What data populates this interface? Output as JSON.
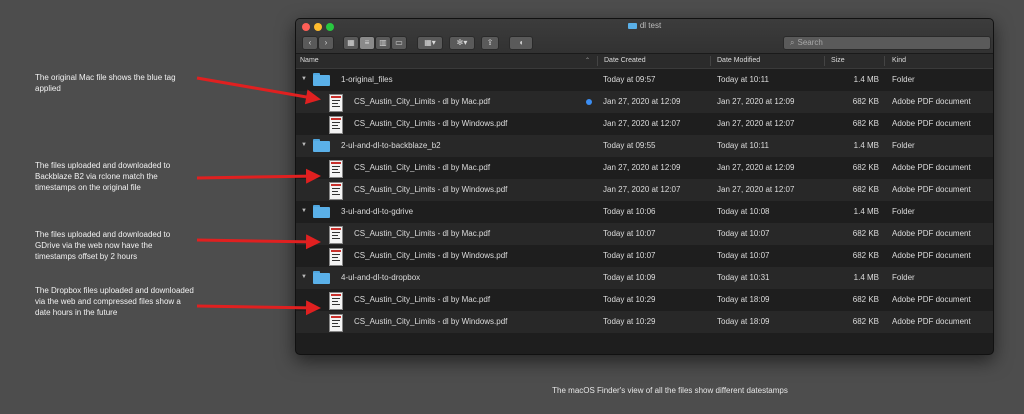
{
  "annotations": [
    "The original Mac file shows the blue tag applied",
    "The files uploaded and downloaded to Backblaze B2 via rclone match the timestamps on the original file",
    "The files uploaded and downloaded to GDrive via the web now have the timestamps offset by 2 hours",
    "The Dropbox files uploaded and downloaded via the web and compressed files show a date hours in the future"
  ],
  "caption": "The macOS Finder's view of all the files show different datestamps",
  "window": {
    "title": "dl test",
    "search_placeholder": "Search",
    "columns": {
      "name": "Name",
      "date_created": "Date Created",
      "date_modified": "Date Modified",
      "size": "Size",
      "kind": "Kind"
    }
  },
  "rows": [
    {
      "type": "folder",
      "name": "1-original_files",
      "created": "Today at 09:57",
      "modified": "Today at 10:11",
      "size": "1.4 MB",
      "kind": "Folder"
    },
    {
      "type": "pdf",
      "name": "CS_Austin_City_Limits - dl by Mac.pdf",
      "created": "Jan 27, 2020 at 12:09",
      "modified": "Jan 27, 2020 at 12:09",
      "size": "682 KB",
      "kind": "Adobe PDF document",
      "tag": "blue"
    },
    {
      "type": "pdf",
      "name": "CS_Austin_City_Limits - dl by Windows.pdf",
      "created": "Jan 27, 2020 at 12:07",
      "modified": "Jan 27, 2020 at 12:07",
      "size": "682 KB",
      "kind": "Adobe PDF document"
    },
    {
      "type": "folder",
      "name": "2-ul-and-dl-to-backblaze_b2",
      "created": "Today at 09:55",
      "modified": "Today at 10:11",
      "size": "1.4 MB",
      "kind": "Folder"
    },
    {
      "type": "pdf",
      "name": "CS_Austin_City_Limits - dl by Mac.pdf",
      "created": "Jan 27, 2020 at 12:09",
      "modified": "Jan 27, 2020 at 12:09",
      "size": "682 KB",
      "kind": "Adobe PDF document"
    },
    {
      "type": "pdf",
      "name": "CS_Austin_City_Limits - dl by Windows.pdf",
      "created": "Jan 27, 2020 at 12:07",
      "modified": "Jan 27, 2020 at 12:07",
      "size": "682 KB",
      "kind": "Adobe PDF document"
    },
    {
      "type": "folder",
      "name": "3-ul-and-dl-to-gdrive",
      "created": "Today at 10:06",
      "modified": "Today at 10:08",
      "size": "1.4 MB",
      "kind": "Folder"
    },
    {
      "type": "pdf",
      "name": "CS_Austin_City_Limits - dl by Mac.pdf",
      "created": "Today at 10:07",
      "modified": "Today at 10:07",
      "size": "682 KB",
      "kind": "Adobe PDF document"
    },
    {
      "type": "pdf",
      "name": "CS_Austin_City_Limits - dl by Windows.pdf",
      "created": "Today at 10:07",
      "modified": "Today at 10:07",
      "size": "682 KB",
      "kind": "Adobe PDF document"
    },
    {
      "type": "folder",
      "name": "4-ul-and-dl-to-dropbox",
      "created": "Today at 10:09",
      "modified": "Today at 10:31",
      "size": "1.4 MB",
      "kind": "Folder"
    },
    {
      "type": "pdf",
      "name": "CS_Austin_City_Limits - dl by Mac.pdf",
      "created": "Today at 10:29",
      "modified": "Today at 18:09",
      "size": "682 KB",
      "kind": "Adobe PDF document"
    },
    {
      "type": "pdf",
      "name": "CS_Austin_City_Limits - dl by Windows.pdf",
      "created": "Today at 10:29",
      "modified": "Today at 18:09",
      "size": "682 KB",
      "kind": "Adobe PDF document"
    }
  ],
  "colors": {
    "arrow": "#e02020",
    "tag_blue": "#3b8ef3",
    "folder": "#5ab0e8"
  },
  "icons": [
    "back-icon",
    "forward-icon",
    "icon-view-icon",
    "list-view-icon",
    "column-view-icon",
    "gallery-view-icon",
    "group-icon",
    "gear-icon",
    "share-icon",
    "tag-icon",
    "search-icon",
    "folder-icon",
    "pdf-file-icon",
    "disclosure-triangle-icon"
  ]
}
